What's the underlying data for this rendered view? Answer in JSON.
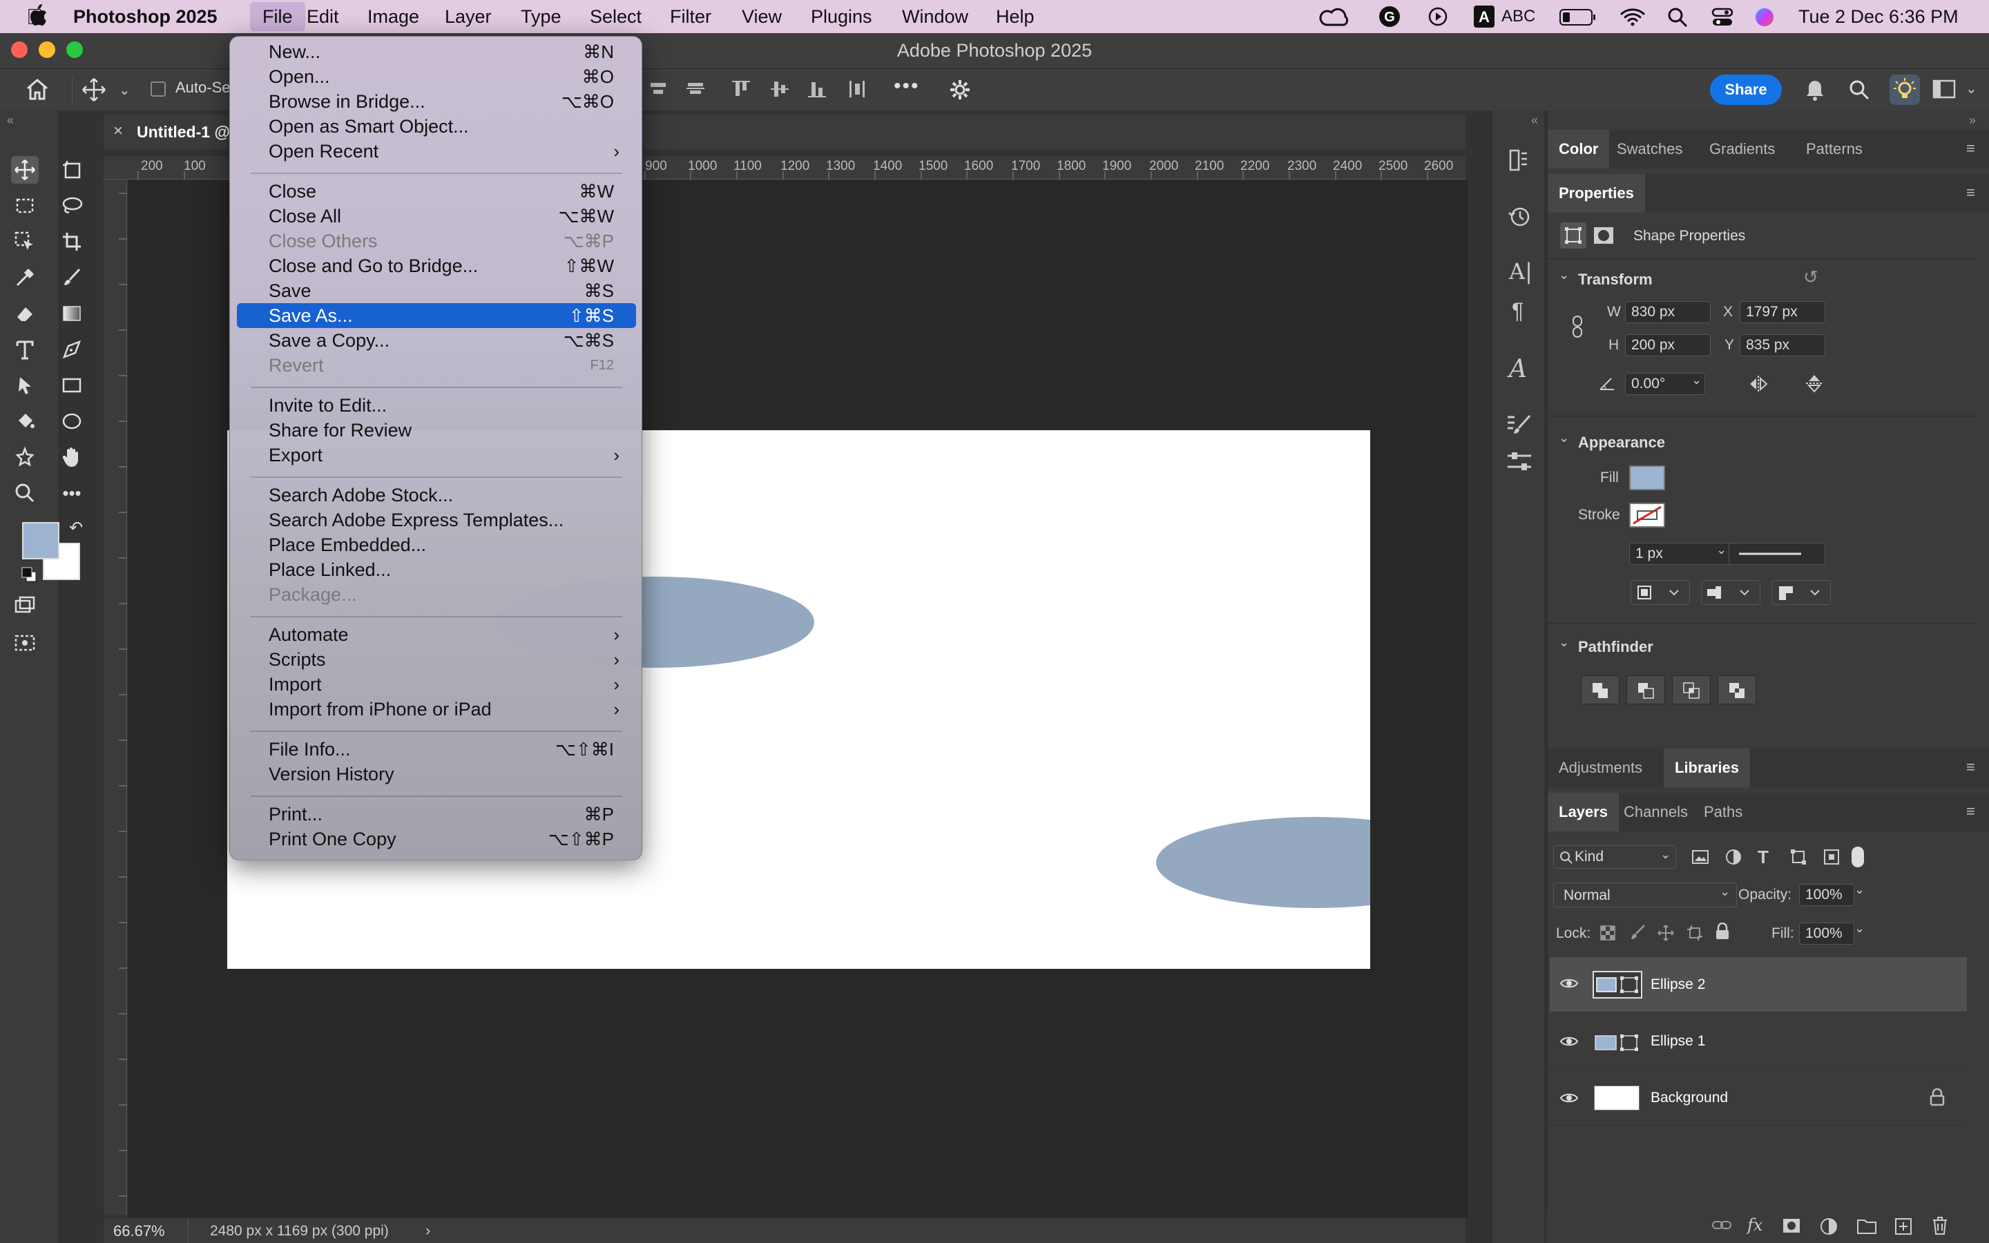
{
  "mac_menubar": {
    "app_name": "Photoshop 2025",
    "menus": [
      "File",
      "Edit",
      "Image",
      "Layer",
      "Type",
      "Select",
      "Filter",
      "View",
      "Plugins",
      "Window",
      "Help"
    ],
    "active_menu": "File",
    "input_source": "ABC",
    "datetime": "Tue 2 Dec  6:36 PM"
  },
  "window": {
    "title": "Adobe Photoshop 2025"
  },
  "options_bar": {
    "auto_select_label": "Auto-Se",
    "share_label": "Share"
  },
  "document": {
    "tab_label": "Untitled-1 @",
    "zoom": "66.67%",
    "doc_info": "2480 px x 1169 px (300 ppi)",
    "ruler_ticks": [
      "200",
      "100",
      "900",
      "1000",
      "1100",
      "1200",
      "1300",
      "1400",
      "1500",
      "1600",
      "1700",
      "1800",
      "1900",
      "2000",
      "2100",
      "2200",
      "2300",
      "2400",
      "2500",
      "2600"
    ]
  },
  "colors": {
    "foreground": "#9cb4d2",
    "background": "#ffffff",
    "ellipse_fill": "#94a9c0",
    "menu_highlight": "#1761d1",
    "share_button": "#1473e6"
  },
  "file_menu": {
    "items": [
      {
        "label": "New...",
        "shortcut": "⌘N"
      },
      {
        "label": "Open...",
        "shortcut": "⌘O"
      },
      {
        "label": "Browse in Bridge...",
        "shortcut": "⌥⌘O"
      },
      {
        "label": "Open as Smart Object...",
        "shortcut": ""
      },
      {
        "label": "Open Recent",
        "shortcut": "›"
      },
      {
        "label": "Close",
        "shortcut": "⌘W"
      },
      {
        "label": "Close All",
        "shortcut": "⌥⌘W"
      },
      {
        "label": "Close Others",
        "shortcut": "⌥⌘P"
      },
      {
        "label": "Close and Go to Bridge...",
        "shortcut": "⇧⌘W"
      },
      {
        "label": "Save",
        "shortcut": "⌘S"
      },
      {
        "label": "Save As...",
        "shortcut": "⇧⌘S"
      },
      {
        "label": "Save a Copy...",
        "shortcut": "⌥⌘S"
      },
      {
        "label": "Revert",
        "shortcut": "F12"
      },
      {
        "label": "Invite to Edit...",
        "shortcut": ""
      },
      {
        "label": "Share for Review",
        "shortcut": ""
      },
      {
        "label": "Export",
        "shortcut": "›"
      },
      {
        "label": "Search Adobe Stock...",
        "shortcut": ""
      },
      {
        "label": "Search Adobe Express Templates...",
        "shortcut": ""
      },
      {
        "label": "Place Embedded...",
        "shortcut": ""
      },
      {
        "label": "Place Linked...",
        "shortcut": ""
      },
      {
        "label": "Package...",
        "shortcut": ""
      },
      {
        "label": "Automate",
        "shortcut": "›"
      },
      {
        "label": "Scripts",
        "shortcut": "›"
      },
      {
        "label": "Import",
        "shortcut": "›"
      },
      {
        "label": "Import from iPhone or iPad",
        "shortcut": "›"
      },
      {
        "label": "File Info...",
        "shortcut": "⌥⇧⌘I"
      },
      {
        "label": "Version History",
        "shortcut": ""
      },
      {
        "label": "Print...",
        "shortcut": "⌘P"
      },
      {
        "label": "Print One Copy",
        "shortcut": "⌥⇧⌘P"
      }
    ]
  },
  "panels": {
    "top_tabs": [
      "Color",
      "Swatches",
      "Gradients",
      "Patterns"
    ],
    "properties_tab": "Properties",
    "shape_properties": "Shape Properties",
    "transform": {
      "title": "Transform",
      "w_label": "W",
      "w": "830 px",
      "x_label": "X",
      "x": "1797 px",
      "h_label": "H",
      "h": "200 px",
      "y_label": "Y",
      "y": "835 px",
      "angle": "0.00°"
    },
    "appearance": {
      "title": "Appearance",
      "fill_label": "Fill",
      "stroke_label": "Stroke",
      "stroke_width": "1 px"
    },
    "pathfinder": {
      "title": "Pathfinder"
    },
    "mid_tabs": [
      "Adjustments",
      "Libraries"
    ],
    "layer_tabs": [
      "Layers",
      "Channels",
      "Paths"
    ],
    "kind_filter": "Kind",
    "blend_mode": "Normal",
    "opacity_label": "Opacity:",
    "opacity": "100%",
    "lock_label": "Lock:",
    "fill_label": "Fill:",
    "fill": "100%",
    "layers": [
      "Ellipse 2",
      "Ellipse 1",
      "Background"
    ]
  }
}
